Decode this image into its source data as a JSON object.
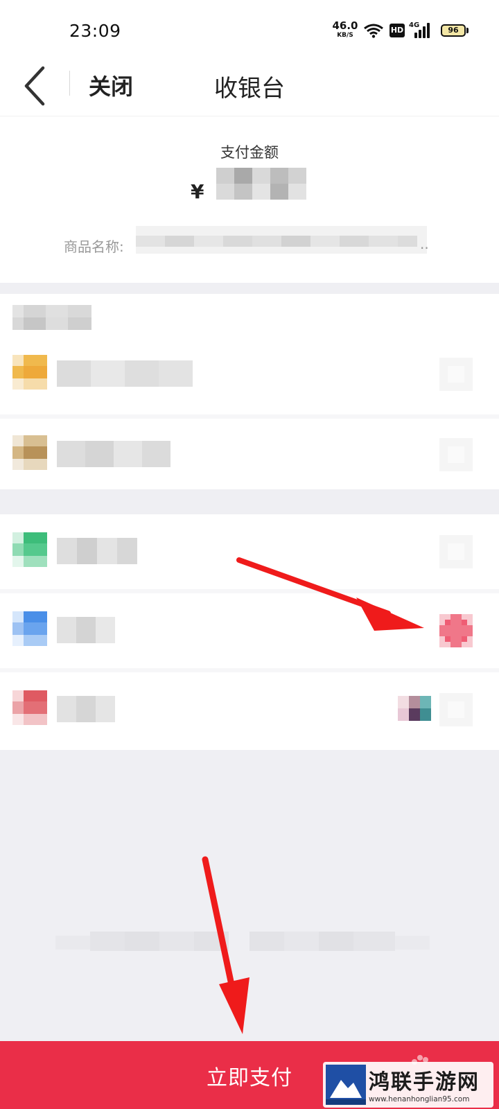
{
  "status_bar": {
    "time": "23:09",
    "net_speed_value": "46.0",
    "net_speed_unit": "KB/S",
    "hd_label": "HD",
    "signal_label": "4G",
    "battery_level": "96"
  },
  "nav": {
    "back_icon": "chevron-left-icon",
    "close_label": "关闭",
    "title": "收银台"
  },
  "amount": {
    "label": "支付金额",
    "currency_symbol": "¥",
    "value_obscured": true
  },
  "product": {
    "label": "商品名称:",
    "name_obscured": true,
    "ellipsis": ".."
  },
  "payment_sections": [
    {
      "header_obscured": true,
      "methods": [
        {
          "icon": "yellow-wallet-icon",
          "accent": "#f0b94d",
          "name_obscured": true,
          "selected": false
        },
        {
          "icon": "tan-wallet-icon",
          "accent": "#c9a66a",
          "name_obscured": true,
          "selected": false
        }
      ]
    },
    {
      "methods": [
        {
          "icon": "green-wechat-icon",
          "accent": "#3dbd7a",
          "name_obscured": true,
          "selected": false
        },
        {
          "icon": "blue-alipay-icon",
          "accent": "#4a8fe8",
          "name_obscured": true,
          "selected": true
        },
        {
          "icon": "red-unionpay-icon",
          "accent": "#df5a62",
          "name_obscured": true,
          "selected": false,
          "has_badge": true
        }
      ]
    }
  ],
  "pay_button": {
    "label": "立即支付",
    "color": "#ea2e48"
  },
  "annotation_color": "#ef1b1b",
  "watermark": {
    "text": "鸿联手游网",
    "url": "www.henanhonglian95.com"
  }
}
